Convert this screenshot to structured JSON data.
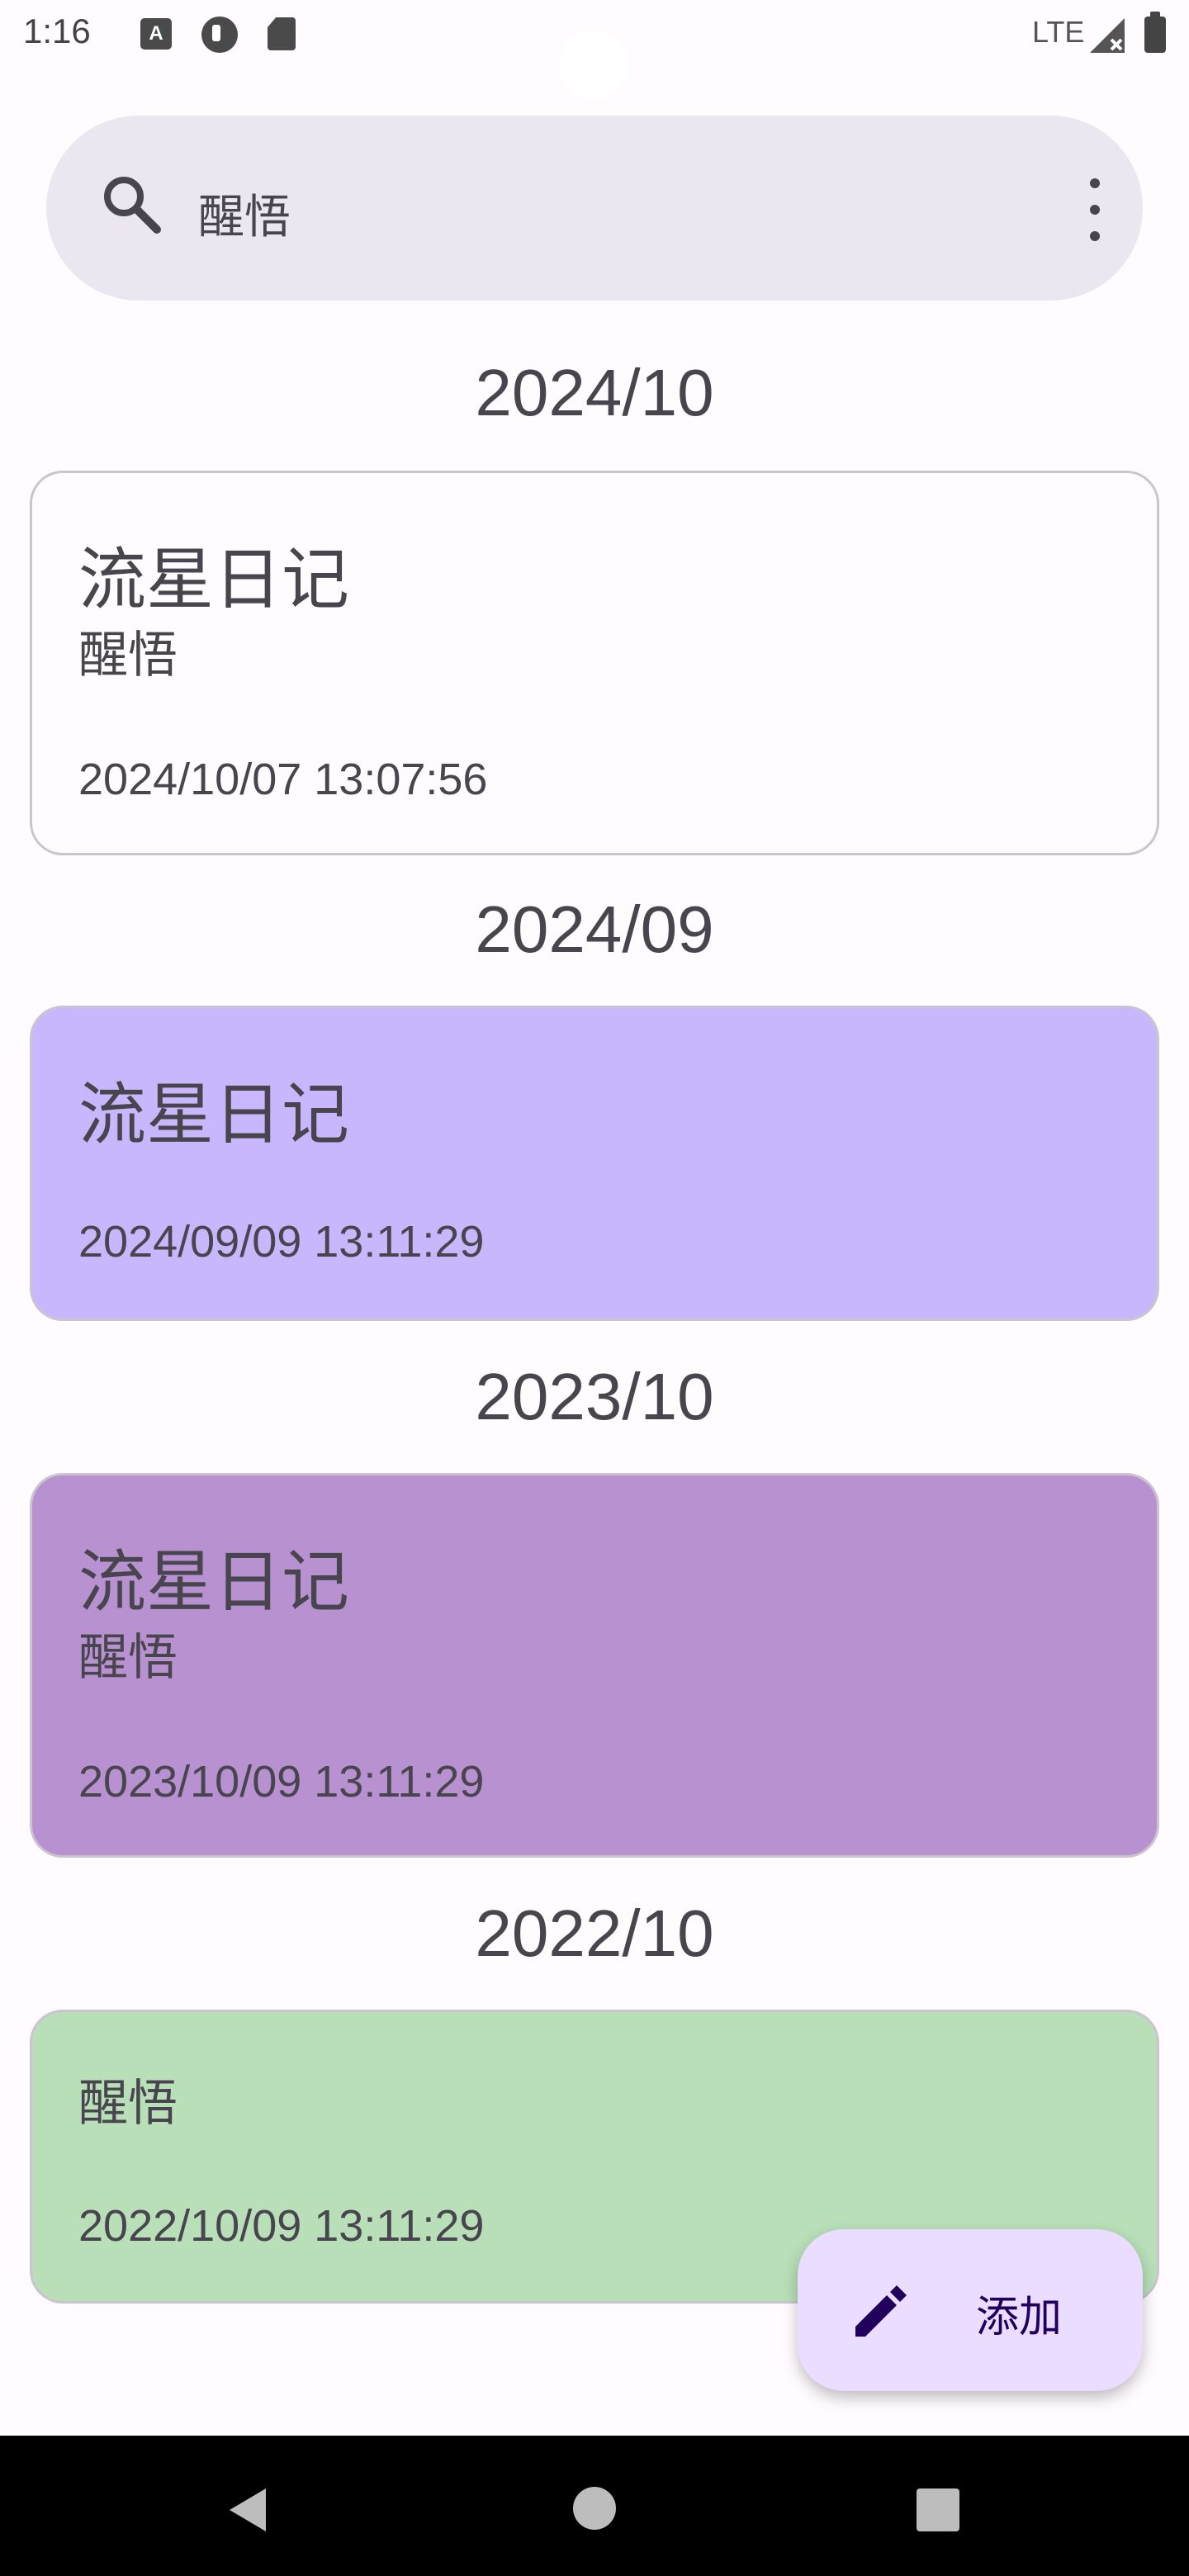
{
  "status_bar": {
    "time": "1:16",
    "a_icon_text": "A",
    "network": "LTE"
  },
  "search": {
    "query": "醒悟"
  },
  "sections": [
    {
      "header": "2024/10",
      "card": {
        "title": "流星日记",
        "subtitle": "醒悟",
        "date": "2024/10/07 13:07:56",
        "color": "#fffbfe"
      }
    },
    {
      "header": "2024/09",
      "card": {
        "title": "流星日记",
        "subtitle": "",
        "date": "2024/09/09 13:11:29",
        "color": "#c9b7fd"
      }
    },
    {
      "header": "2023/10",
      "card": {
        "title": "流星日记",
        "subtitle": "醒悟",
        "date": "2023/10/09 13:11:29",
        "color": "#b891d0"
      }
    },
    {
      "header": "2022/10",
      "card": {
        "title": "",
        "subtitle": "醒悟",
        "date": "2022/10/09 13:11:29",
        "color": "#b8dfb8"
      }
    }
  ],
  "fab": {
    "label": "添加",
    "icon": "pencil-icon"
  },
  "nav": {
    "back_icon": "back-icon",
    "home_icon": "home-icon",
    "recents_icon": "recents-icon"
  }
}
